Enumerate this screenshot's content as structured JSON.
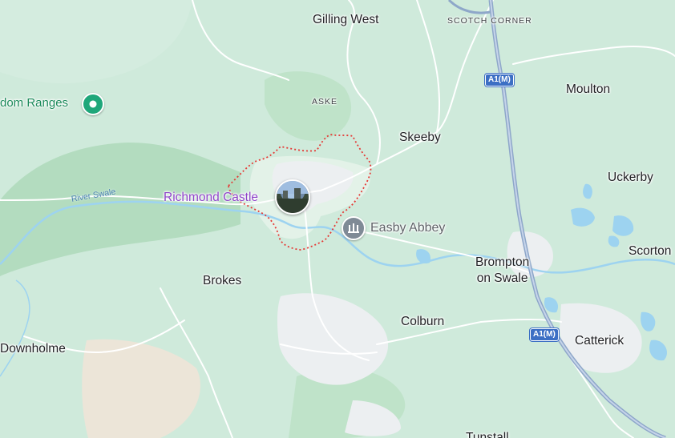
{
  "map": {
    "colors": {
      "land": "#cfeadb",
      "forest": "#b6dfc3",
      "urban": "#eceff1",
      "road": "#ffffff",
      "motorway": "#8ea7c9",
      "water": "#9dd3f0",
      "boundary": "#e53935",
      "sand": "#ece5d8"
    },
    "places": {
      "gilling_west": "Gilling West",
      "scotch_corner": "SCOTCH CORNER",
      "aske": "ASKE",
      "moulton": "Moulton",
      "skeeby": "Skeeby",
      "uckerby": "Uckerby",
      "scorton": "Scorton",
      "brompton": "Brompton\non Swale",
      "brokes": "Brokes",
      "colburn": "Colburn",
      "downholme": "Downholme",
      "catterick": "Catterick",
      "bottom_cut": "Tunstall"
    },
    "pois": {
      "richmond_castle": "Richmond Castle",
      "easby_abbey": "Easby Abbey",
      "ranges": "dom Ranges"
    },
    "river": "River Swale",
    "roads": {
      "a1m_north": "A1(M)",
      "a1m_south": "A1(M)"
    },
    "icons": {
      "photo_pin": "castle-photo-pin-icon",
      "abbey": "monument-icon",
      "ranges": "location-pin-icon"
    }
  }
}
